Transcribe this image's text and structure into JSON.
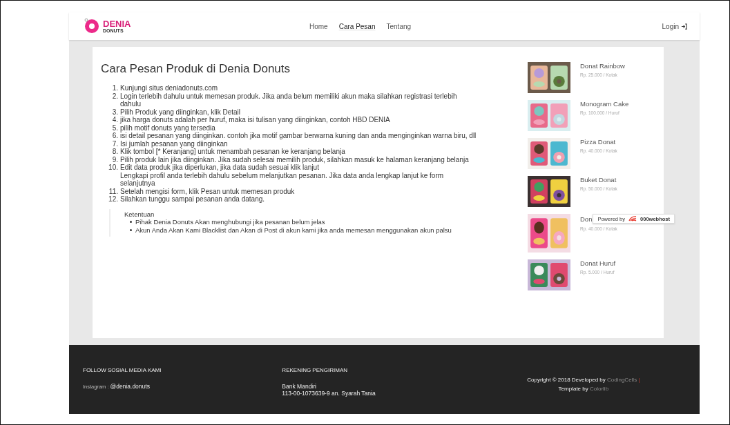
{
  "navbar": {
    "logo": {
      "name": "DENIA",
      "tagline": "DONUTS"
    },
    "links": [
      {
        "label": "Home",
        "selected": false
      },
      {
        "label": "Cara Pesan",
        "selected": true
      },
      {
        "label": "Tentang",
        "selected": false
      }
    ],
    "login": "Login"
  },
  "content": {
    "title": "Cara Pesan Produk di Denia Donuts",
    "steps": [
      {
        "number": "1.",
        "text": "Kunjungi situs deniadonuts.com"
      },
      {
        "number": "2.",
        "text": "Login terlebih dahulu untuk memesan produk. Jika anda belum memiliki akun maka silahkan registrasi terlebih dahulu"
      },
      {
        "number": "3.",
        "text": "Pilih Produk yang diinginkan, klik Detail"
      },
      {
        "number": "4.",
        "text": "jika harga donuts adalah per huruf, maka isi tulisan yang diinginkan, contoh HBD DENIA"
      },
      {
        "number": "5.",
        "text": "pilih motif donuts yang tersedia"
      },
      {
        "number": "6.",
        "text": "isi detail pesanan yang diinginkan. contoh jika motif gambar berwarna kuning dan anda menginginkan warna biru, dll"
      },
      {
        "number": "7.",
        "text": "Isi jumlah pesanan yang diinginkan"
      },
      {
        "number": "8.",
        "text": "Klik tombol [* Keranjang] untuk menambah pesanan ke keranjang belanja"
      },
      {
        "number": "9.",
        "text": "Pilih produk lain jika diinginkan. Jika sudah selesai memilih produk, silahkan masuk ke halaman keranjang belanja"
      },
      {
        "number": "10.",
        "text": "Edit data produk jika diperlukan, jika data sudah sesuai klik lanjut",
        "note": "Lengkapi profil anda terlebih dahulu sebelum melanjutkan pesanan. Jika data anda lengkap lanjut ke form selanjutnya"
      },
      {
        "number": "11.",
        "text": "Setelah mengisi form, klik Pesan untuk memesan produk"
      },
      {
        "number": "12.",
        "text": "Silahkan tunggu sampai pesanan anda datang."
      }
    ],
    "terms": {
      "title": "Ketentuan",
      "items": [
        "Pihak Denia Donuts Akan menghubungi jika pesanan belum jelas",
        "Akun Anda Akan Kami Blacklist dan Akan di Post di akun kami jika anda memesan menggunakan akun palsu"
      ]
    }
  },
  "products": [
    {
      "name": "Donat Rainbow",
      "price": "Rp. 25.000 / Kotak",
      "kind": "picture"
    },
    {
      "name": "Monogram Cake",
      "price": "Rp. 100.000 / Huruf",
      "kind": "picture"
    },
    {
      "name": "Pizza Donat",
      "price": "Rp. 40.000 / Kotak",
      "kind": "picture"
    },
    {
      "name": "Buket Donat",
      "price": "Rp. 50.000 / Kotak",
      "kind": "picture"
    },
    {
      "name": "Don",
      "price": "Rp. 40.000 / Kotak",
      "kind": "picture"
    },
    {
      "name": "Donat Huruf",
      "price": "Rp. 5.000 / Huruf",
      "kind": "picture"
    }
  ],
  "badge": {
    "prefix": "Powered by",
    "brand": "000webhost"
  },
  "footer": {
    "social": {
      "heading": "FOLLOW SOSIAL MEDIA KAMI",
      "label": "Instagram :",
      "handle": "@denia.donuts"
    },
    "bank": {
      "heading": "REKENING PENGIRIMAN",
      "name": "Bank Mandiri",
      "account": "113-00-1073639-9 an. Syarah Tania"
    },
    "credits": {
      "copyright": "Copyright © 2018 Developed by",
      "developer": "CodingCells",
      "separator": "|",
      "template": "Template by",
      "template_author": "Colorlib"
    }
  }
}
